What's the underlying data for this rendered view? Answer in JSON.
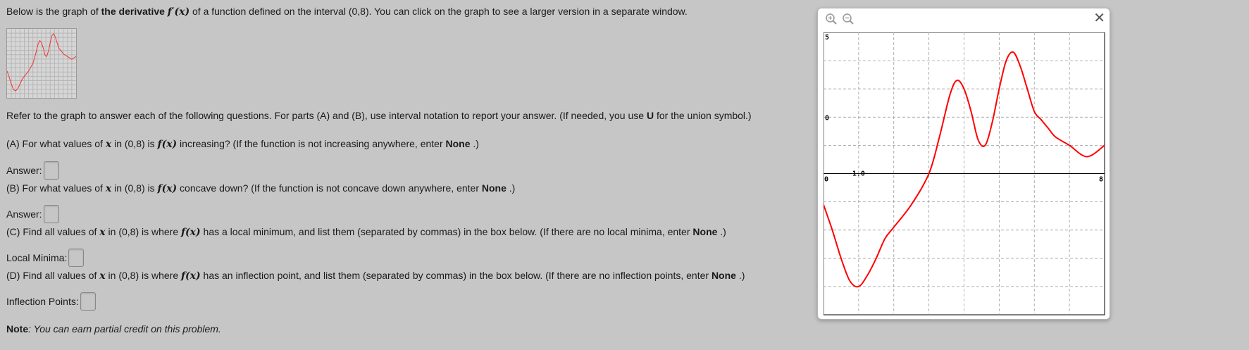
{
  "intro": {
    "before": "Below is the graph of ",
    "bold": "the derivative",
    "math": "f′(x)",
    "after": " of a function defined on the interval (0,8). You can click on the graph to see a larger version in a separate window."
  },
  "refer": {
    "before": "Refer to the graph to answer each of the following questions. For parts (A) and (B), use interval notation to report your answer. (If needed, you use ",
    "bold": "U",
    "after": " for the union symbol.)"
  },
  "qa": {
    "a1": "(A) For what values of ",
    "x": "x",
    "a2": " in (0,8) is ",
    "fx": "f(x)",
    "a3": " increasing? (If the function is not increasing anywhere, enter ",
    "none": "None",
    "end": " .)"
  },
  "qb": {
    "a1": "(B) For what values of ",
    "x": "x",
    "a2": " in (0,8) is ",
    "fx": "f(x)",
    "a3": " concave down? (If the function is not concave down anywhere, enter ",
    "none": "None",
    "end": " .)"
  },
  "qc": {
    "a1": "(C) Find all values of ",
    "x": "x",
    "a2": " in (0,8) is where ",
    "fx": "f(x)",
    "a3": " has a local minimum, and list them (separated by commas) in the box below. (If there are no local minima, enter ",
    "none": "None",
    "end": " .)"
  },
  "qd": {
    "a1": "(D) Find all values of ",
    "x": "x",
    "a2": " in (0,8) is where ",
    "fx": "f(x)",
    "a3": " has an inflection point, and list them (separated by commas) in the box below. (If there are no inflection points, enter ",
    "none": "None",
    "end": " .)"
  },
  "answers": {
    "answer_label": "Answer:",
    "minima_label": "Local Minima:",
    "inflection_label": "Inflection Points:"
  },
  "note": {
    "label": "Note",
    "text": ": You can earn partial credit on this problem."
  },
  "popup": {
    "zoom_in_icon": "zoom-in-icon",
    "zoom_out_icon": "zoom-out-icon",
    "close_glyph": "✕"
  },
  "chart_data": {
    "type": "line",
    "title": "",
    "xlabel": "",
    "ylabel": "",
    "xlim": [
      0,
      8
    ],
    "ylim": [
      -5,
      5
    ],
    "tick_labels": {
      "x_left": "0",
      "x_right": "8",
      "x_mark": "1.0",
      "y_top": "5",
      "y_mid": "0"
    },
    "grid": true,
    "line_color": "#ff0000",
    "series": [
      {
        "x": [
          0,
          0.25,
          0.5,
          0.75,
          1.0,
          1.25,
          1.5,
          1.75,
          2.0,
          2.5,
          3.0,
          3.3,
          3.6,
          3.8,
          4.0,
          4.2,
          4.4,
          4.6,
          4.8,
          5.0,
          5.2,
          5.4,
          5.6,
          5.8,
          6.0,
          6.2,
          6.4,
          6.6,
          7.0,
          7.5,
          8.0
        ],
        "y": [
          -1.1,
          -2.0,
          -3.0,
          -3.8,
          -4.0,
          -3.6,
          -3.0,
          -2.3,
          -1.9,
          -1.1,
          0.0,
          1.3,
          2.8,
          3.3,
          3.0,
          2.2,
          1.2,
          1.0,
          1.8,
          3.0,
          4.0,
          4.3,
          3.8,
          3.0,
          2.2,
          1.9,
          1.6,
          1.3,
          1.0,
          0.6,
          1.0
        ]
      }
    ]
  }
}
